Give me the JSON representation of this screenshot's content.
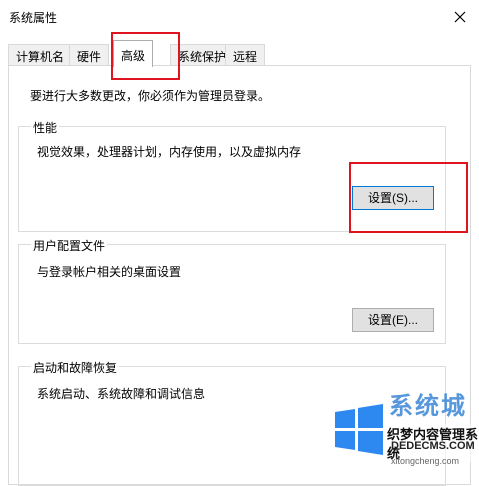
{
  "window": {
    "title": "系统属性"
  },
  "tabs": [
    {
      "label": "计算机名"
    },
    {
      "label": "硬件"
    },
    {
      "label": "高级"
    },
    {
      "label": "系统保护"
    },
    {
      "label": "远程"
    }
  ],
  "active_tab": "高级",
  "intro_text": "要进行大多数更改，你必须作为管理员登录。",
  "performance": {
    "title": "性能",
    "description": "视觉效果，处理器计划，内存使用，以及虚拟内存",
    "button_label": "设置(S)..."
  },
  "user_profiles": {
    "title": "用户配置文件",
    "description": "与登录帐户相关的桌面设置",
    "button_label": "设置(E)..."
  },
  "startup_recovery": {
    "title": "启动和故障恢复",
    "description": "系统启动、系统故障和调试信息"
  },
  "watermark": {
    "chinese": "系统城",
    "brand": "织梦内容管理系统",
    "site": "DEDECMS.COM",
    "url": "xitongcheng.com"
  },
  "colors": {
    "highlight_box": "#e0141e",
    "button_face": "#e1e1e1",
    "focus_border": "#0078d7"
  }
}
